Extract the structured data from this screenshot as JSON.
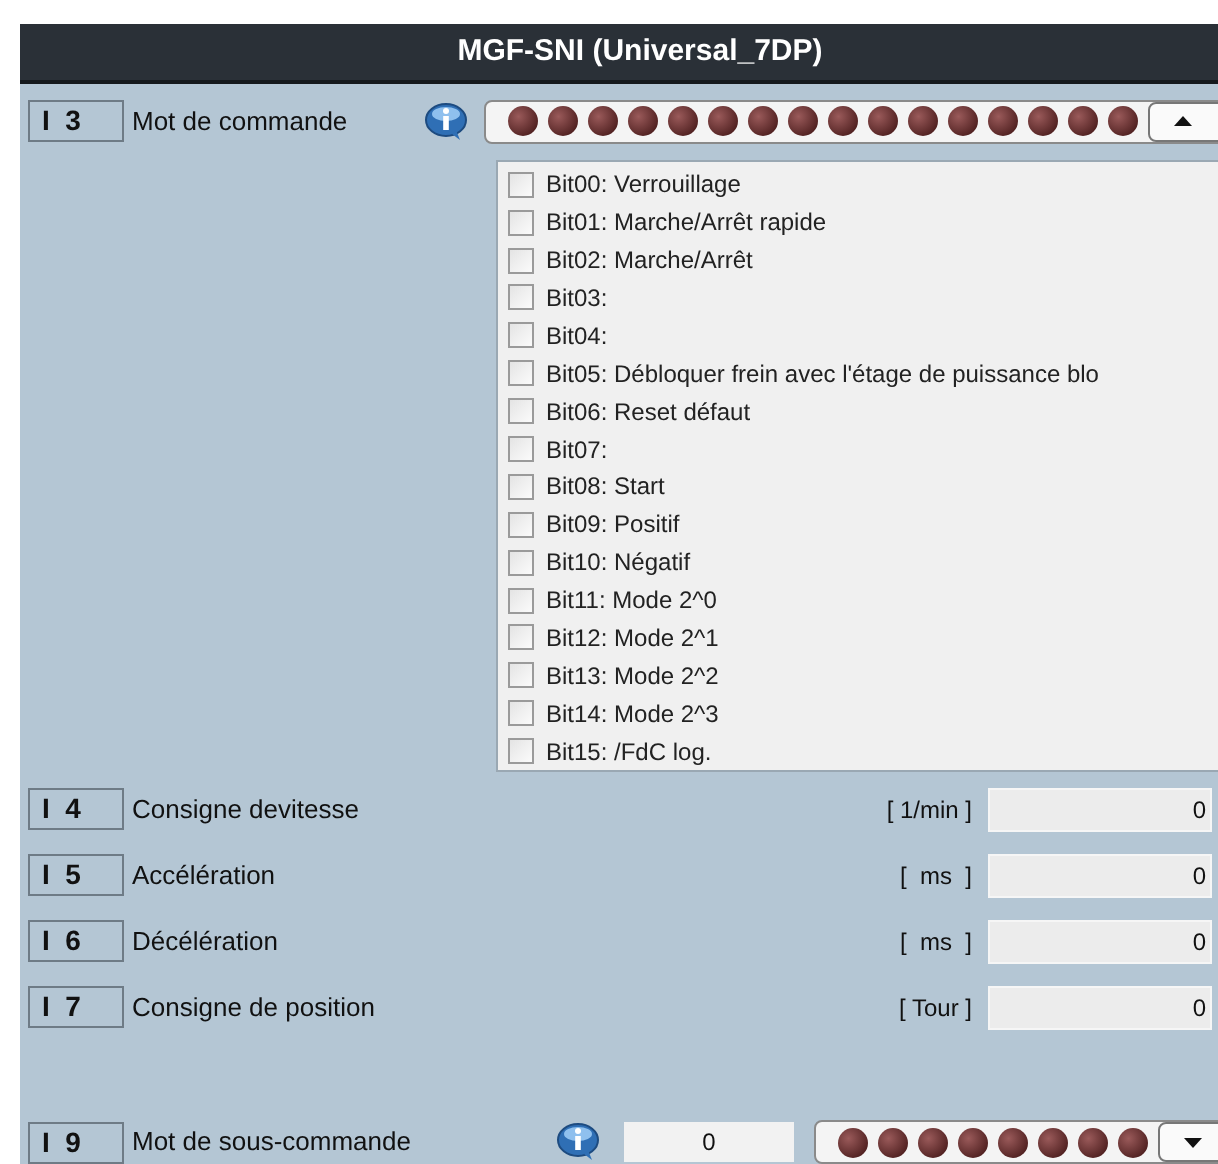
{
  "window": {
    "title": "MGF-SNI (Universal_7DP)"
  },
  "command_word": {
    "id": "I  3",
    "label": "Mot de commande",
    "expanded": true,
    "leds": [
      {
        "on": false
      },
      {
        "on": false
      },
      {
        "on": false
      },
      {
        "on": false
      },
      {
        "on": false
      },
      {
        "on": false
      },
      {
        "on": false
      },
      {
        "on": false
      },
      {
        "on": false
      },
      {
        "on": false
      },
      {
        "on": false
      },
      {
        "on": false
      },
      {
        "on": false
      },
      {
        "on": false
      },
      {
        "on": false
      },
      {
        "on": false
      }
    ],
    "bits": [
      {
        "label": "Bit00: Verrouillage",
        "checked": false
      },
      {
        "label": "Bit01: Marche/Arrêt rapide",
        "checked": false
      },
      {
        "label": "Bit02: Marche/Arrêt",
        "checked": false
      },
      {
        "label": "Bit03:",
        "checked": false
      },
      {
        "label": "Bit04:",
        "checked": false
      },
      {
        "label": "Bit05: Débloquer frein avec l'étage de puissance blo",
        "checked": false
      },
      {
        "label": "Bit06: Reset défaut",
        "checked": false
      },
      {
        "label": "Bit07:",
        "checked": false
      },
      {
        "label": "Bit08: Start",
        "checked": false
      },
      {
        "label": "Bit09: Positif",
        "checked": false
      },
      {
        "label": "Bit10: Négatif",
        "checked": false
      },
      {
        "label": "Bit11: Mode 2^0",
        "checked": false
      },
      {
        "label": "Bit12: Mode 2^1",
        "checked": false
      },
      {
        "label": "Bit13: Mode 2^2",
        "checked": false
      },
      {
        "label": "Bit14: Mode 2^3",
        "checked": false
      },
      {
        "label": "Bit15: /FdC log.",
        "checked": false
      }
    ]
  },
  "parameters": [
    {
      "id": "I  4",
      "label": "Consigne devitesse",
      "unit": "[ 1/min ]",
      "value": "0"
    },
    {
      "id": "I  5",
      "label": "Accélération",
      "unit": "[  ms  ]",
      "value": "0"
    },
    {
      "id": "I  6",
      "label": "Décélération",
      "unit": "[  ms  ]",
      "value": "0"
    },
    {
      "id": "I  7",
      "label": "Consigne de position",
      "unit": "[ Tour ]",
      "value": "0"
    }
  ],
  "subcommand_word": {
    "id": "I  9",
    "label": "Mot de sous-commande",
    "value": "0",
    "expanded": false,
    "leds": [
      {
        "on": false
      },
      {
        "on": false
      },
      {
        "on": false
      },
      {
        "on": false
      },
      {
        "on": false
      },
      {
        "on": false
      },
      {
        "on": false
      },
      {
        "on": false
      }
    ]
  }
}
